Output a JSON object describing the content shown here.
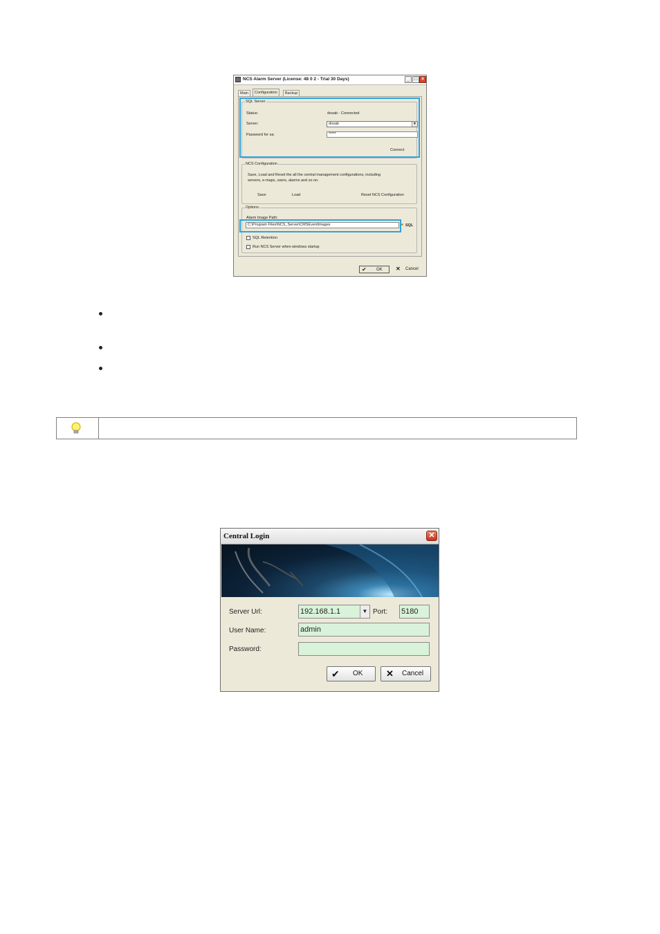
{
  "alarm_server": {
    "title": "NCS Alarm Server (License: 48 0 2 - Trial 30 Days)",
    "tabs": [
      "Main",
      "Configuration",
      "Backup"
    ],
    "sql_server": {
      "group_title": "SQL Server",
      "status_label": "Status:",
      "status_value": "dosab - Connected",
      "server_label": "Server:",
      "server_value": "dosab",
      "password_label": "Password for sa:",
      "password_value": "*****",
      "connect_label": "Connect"
    },
    "ncs_config": {
      "group_title": "NCS Configuration",
      "description_line1": "Save, Load and Reset the all the central management configurations, including",
      "description_line2": "servers, e-maps, users, alarms and so on.",
      "save_label": "Save",
      "load_label": "Load",
      "reset_label": "Reset NCS Configuration"
    },
    "options": {
      "group_title": "Options",
      "path_label": "Alarm Image Path:",
      "path_value": "C:\\Program Files\\NCS_Server\\CMSEventImages",
      "sql_label": "SQL",
      "sql_retention_label": "SQL Retention",
      "run_on_startup_label": "Run NCS Server when windows startup"
    },
    "ok_label": "OK",
    "cancel_label": "Cancel"
  },
  "central_login": {
    "title": "Central Login",
    "server_url_label": "Server Url:",
    "server_url_value": "192.168.1.1",
    "port_label": "Port:",
    "port_value": "5180",
    "user_name_label": "User Name:",
    "user_name_value": "admin",
    "password_label": "Password:",
    "password_value": "",
    "ok_label": "OK",
    "cancel_label": "Cancel"
  },
  "icons": [
    "app-icon",
    "minimize-icon",
    "maximize-icon",
    "close-icon",
    "dropdown-arrow-icon",
    "folder-icon",
    "checkmark-icon",
    "x-icon",
    "lightbulb-icon"
  ],
  "colors": {
    "highlight": "#2ea3dd",
    "login_field": "#d9f2da",
    "window_bg": "#ece9d8"
  }
}
